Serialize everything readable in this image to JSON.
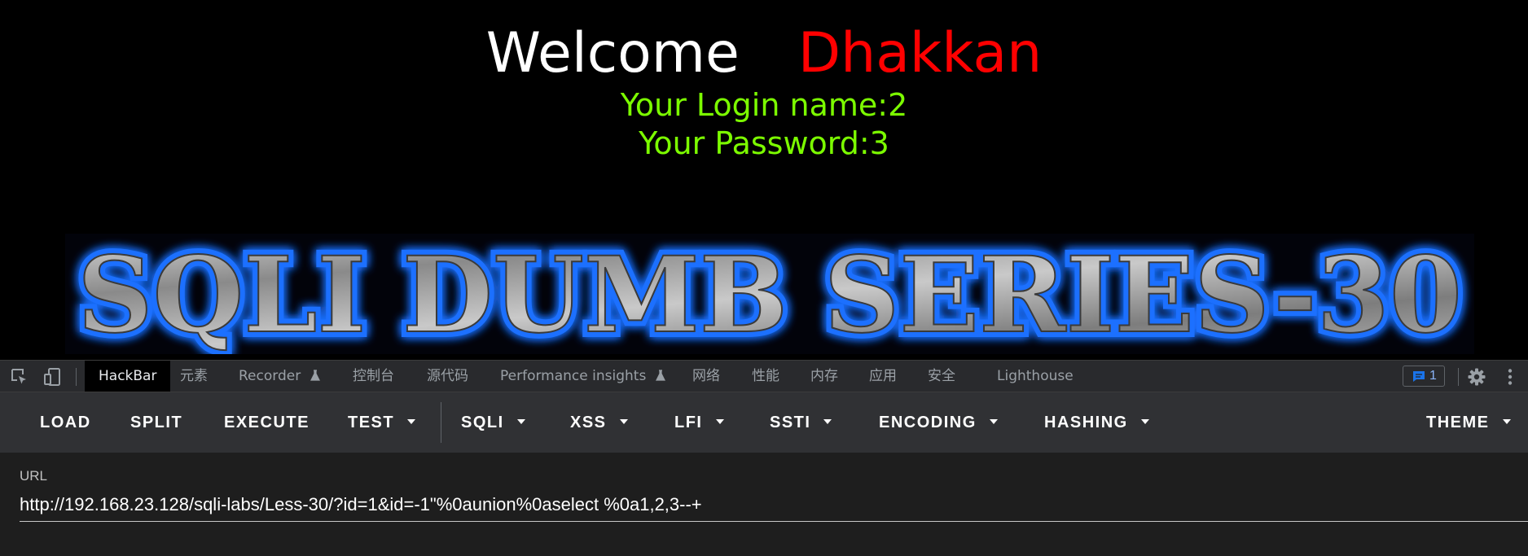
{
  "page": {
    "welcome_word": "Welcome",
    "user_name": "Dhakkan",
    "login_name_line": "Your Login name:2",
    "password_line": "Your Password:3",
    "banner_text": "SQLI DUMB SERIES-30"
  },
  "devtools": {
    "inspect_icon": "element-picker-icon",
    "device_icon": "device-toolbar-icon",
    "tabs": [
      {
        "label": "HackBar",
        "active": true
      },
      {
        "label": "元素"
      },
      {
        "label": "Recorder"
      },
      {
        "label": "控制台"
      },
      {
        "label": "源代码"
      },
      {
        "label": "Performance insights"
      },
      {
        "label": "网络"
      },
      {
        "label": "性能"
      },
      {
        "label": "内存"
      },
      {
        "label": "应用"
      },
      {
        "label": "安全"
      },
      {
        "label": "Lighthouse"
      }
    ],
    "issues_count": "1",
    "settings_icon": "gear-icon",
    "more_icon": "more-vert-icon"
  },
  "hackbar": {
    "buttons": [
      {
        "label": "LOAD"
      },
      {
        "label": "SPLIT"
      },
      {
        "label": "EXECUTE"
      },
      {
        "label": "TEST",
        "dropdown": true
      },
      {
        "label": "SQLI",
        "dropdown": true
      },
      {
        "label": "XSS",
        "dropdown": true
      },
      {
        "label": "LFI",
        "dropdown": true
      },
      {
        "label": "SSTI",
        "dropdown": true
      },
      {
        "label": "ENCODING",
        "dropdown": true
      },
      {
        "label": "HASHING",
        "dropdown": true
      },
      {
        "label": "THEME",
        "dropdown": true
      }
    ],
    "url_label": "URL",
    "url_value": "http://192.168.23.128/sqli-labs/Less-30/?id=1&id=-1\"%0aunion%0aselect %0a1,2,3--+"
  },
  "colors": {
    "welcome": "#ffffff",
    "user_name": "#ff0000",
    "login_text": "#7cfc00",
    "banner_glow": "#1e6fff"
  }
}
